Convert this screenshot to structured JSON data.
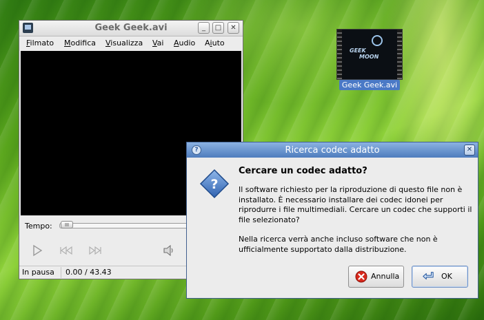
{
  "desktop": {
    "icon_label": "Geek Geek.avi",
    "thumbnail_text": [
      "GEEK",
      "MOON"
    ]
  },
  "player": {
    "title": "Geek Geek.avi",
    "menu": [
      {
        "label": "Filmato",
        "mnemonic": "F"
      },
      {
        "label": "Modifica",
        "mnemonic": "M"
      },
      {
        "label": "Visualizza",
        "mnemonic": "V"
      },
      {
        "label": "Vai",
        "mnemonic": "V"
      },
      {
        "label": "Audio",
        "mnemonic": "A"
      },
      {
        "label": "Aiuto",
        "mnemonic": "i"
      }
    ],
    "seek_label": "Tempo:",
    "seek_position": 0.0,
    "status": "In pausa",
    "time": "0.00 / 43.43"
  },
  "dialog": {
    "title": "Ricerca codec adatto",
    "heading": "Cercare un codec adatto?",
    "paragraph1": "Il software richiesto per la riproduzione di questo file non è installato. È necessario installare dei codec idonei per riprodurre i file multimediali. Cercare un codec che supporti il file selezionato?",
    "paragraph2": "Nella ricerca verrà anche incluso software che non è ufficialmente supportato dalla distribuzione.",
    "cancel_label": "Annulla",
    "ok_label": "OK"
  },
  "colors": {
    "dialog_title": "#5f8bcb",
    "desktop_label": "#4a79c6"
  }
}
